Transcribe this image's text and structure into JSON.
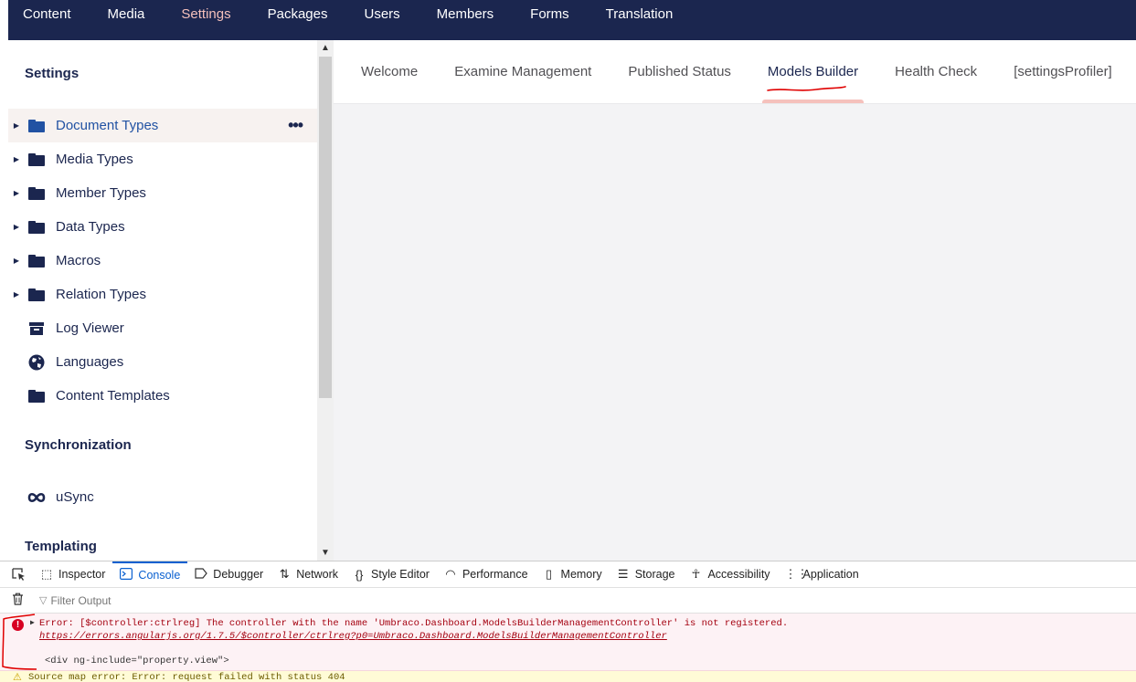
{
  "top_nav": {
    "items": [
      {
        "label": "Content"
      },
      {
        "label": "Media"
      },
      {
        "label": "Settings"
      },
      {
        "label": "Packages"
      },
      {
        "label": "Users"
      },
      {
        "label": "Members"
      },
      {
        "label": "Forms"
      },
      {
        "label": "Translation"
      }
    ],
    "active": "Settings"
  },
  "tree": {
    "sections": [
      {
        "title": "Settings"
      },
      {
        "title": "Synchronization"
      },
      {
        "title": "Templating"
      }
    ],
    "items": [
      {
        "label": "Document Types",
        "icon": "folder-icon",
        "expandable": true,
        "selected": true
      },
      {
        "label": "Media Types",
        "icon": "folder-icon",
        "expandable": true
      },
      {
        "label": "Member Types",
        "icon": "folder-icon",
        "expandable": true
      },
      {
        "label": "Data Types",
        "icon": "folder-icon",
        "expandable": true
      },
      {
        "label": "Macros",
        "icon": "folder-icon",
        "expandable": true
      },
      {
        "label": "Relation Types",
        "icon": "folder-icon",
        "expandable": true
      },
      {
        "label": "Log Viewer",
        "icon": "archive-icon"
      },
      {
        "label": "Languages",
        "icon": "globe-icon"
      },
      {
        "label": "Content Templates",
        "icon": "folder-icon"
      },
      {
        "label": "uSync",
        "icon": "infinity-icon"
      }
    ],
    "more_actions_glyph": "•••"
  },
  "dashboard_tabs": {
    "items": [
      {
        "label": "Welcome"
      },
      {
        "label": "Examine Management"
      },
      {
        "label": "Published Status"
      },
      {
        "label": "Models Builder"
      },
      {
        "label": "Health Check"
      },
      {
        "label": "[settingsProfiler]"
      }
    ],
    "active": "Models Builder"
  },
  "devtools": {
    "tabs": [
      {
        "label": "Inspector",
        "icon": "inspector-icon"
      },
      {
        "label": "Console",
        "icon": "console-icon"
      },
      {
        "label": "Debugger",
        "icon": "debugger-icon"
      },
      {
        "label": "Network",
        "icon": "network-icon"
      },
      {
        "label": "Style Editor",
        "icon": "style-editor-icon"
      },
      {
        "label": "Performance",
        "icon": "performance-icon"
      },
      {
        "label": "Memory",
        "icon": "memory-icon"
      },
      {
        "label": "Storage",
        "icon": "storage-icon"
      },
      {
        "label": "Accessibility",
        "icon": "accessibility-icon"
      },
      {
        "label": "Application",
        "icon": "application-icon"
      }
    ],
    "active": "Console",
    "filter_placeholder": "Filter Output",
    "error": {
      "message": "Error: [$controller:ctrlreg] The controller with the name 'Umbraco.Dashboard.ModelsBuilderManagementController' is not registered.",
      "link": "https://errors.angularjs.org/1.7.5/$controller/ctrlreg?p0=Umbraco.Dashboard.ModelsBuilderManagementController",
      "context": "<div ng-include=\"property.view\">"
    },
    "warning": {
      "message": "Source map error: Error: request failed with status 404"
    }
  },
  "colors": {
    "header_bg": "#1b264f",
    "accent": "#f5c1bc",
    "selected_text": "#2152a3",
    "annotation_red": "#e00000"
  }
}
